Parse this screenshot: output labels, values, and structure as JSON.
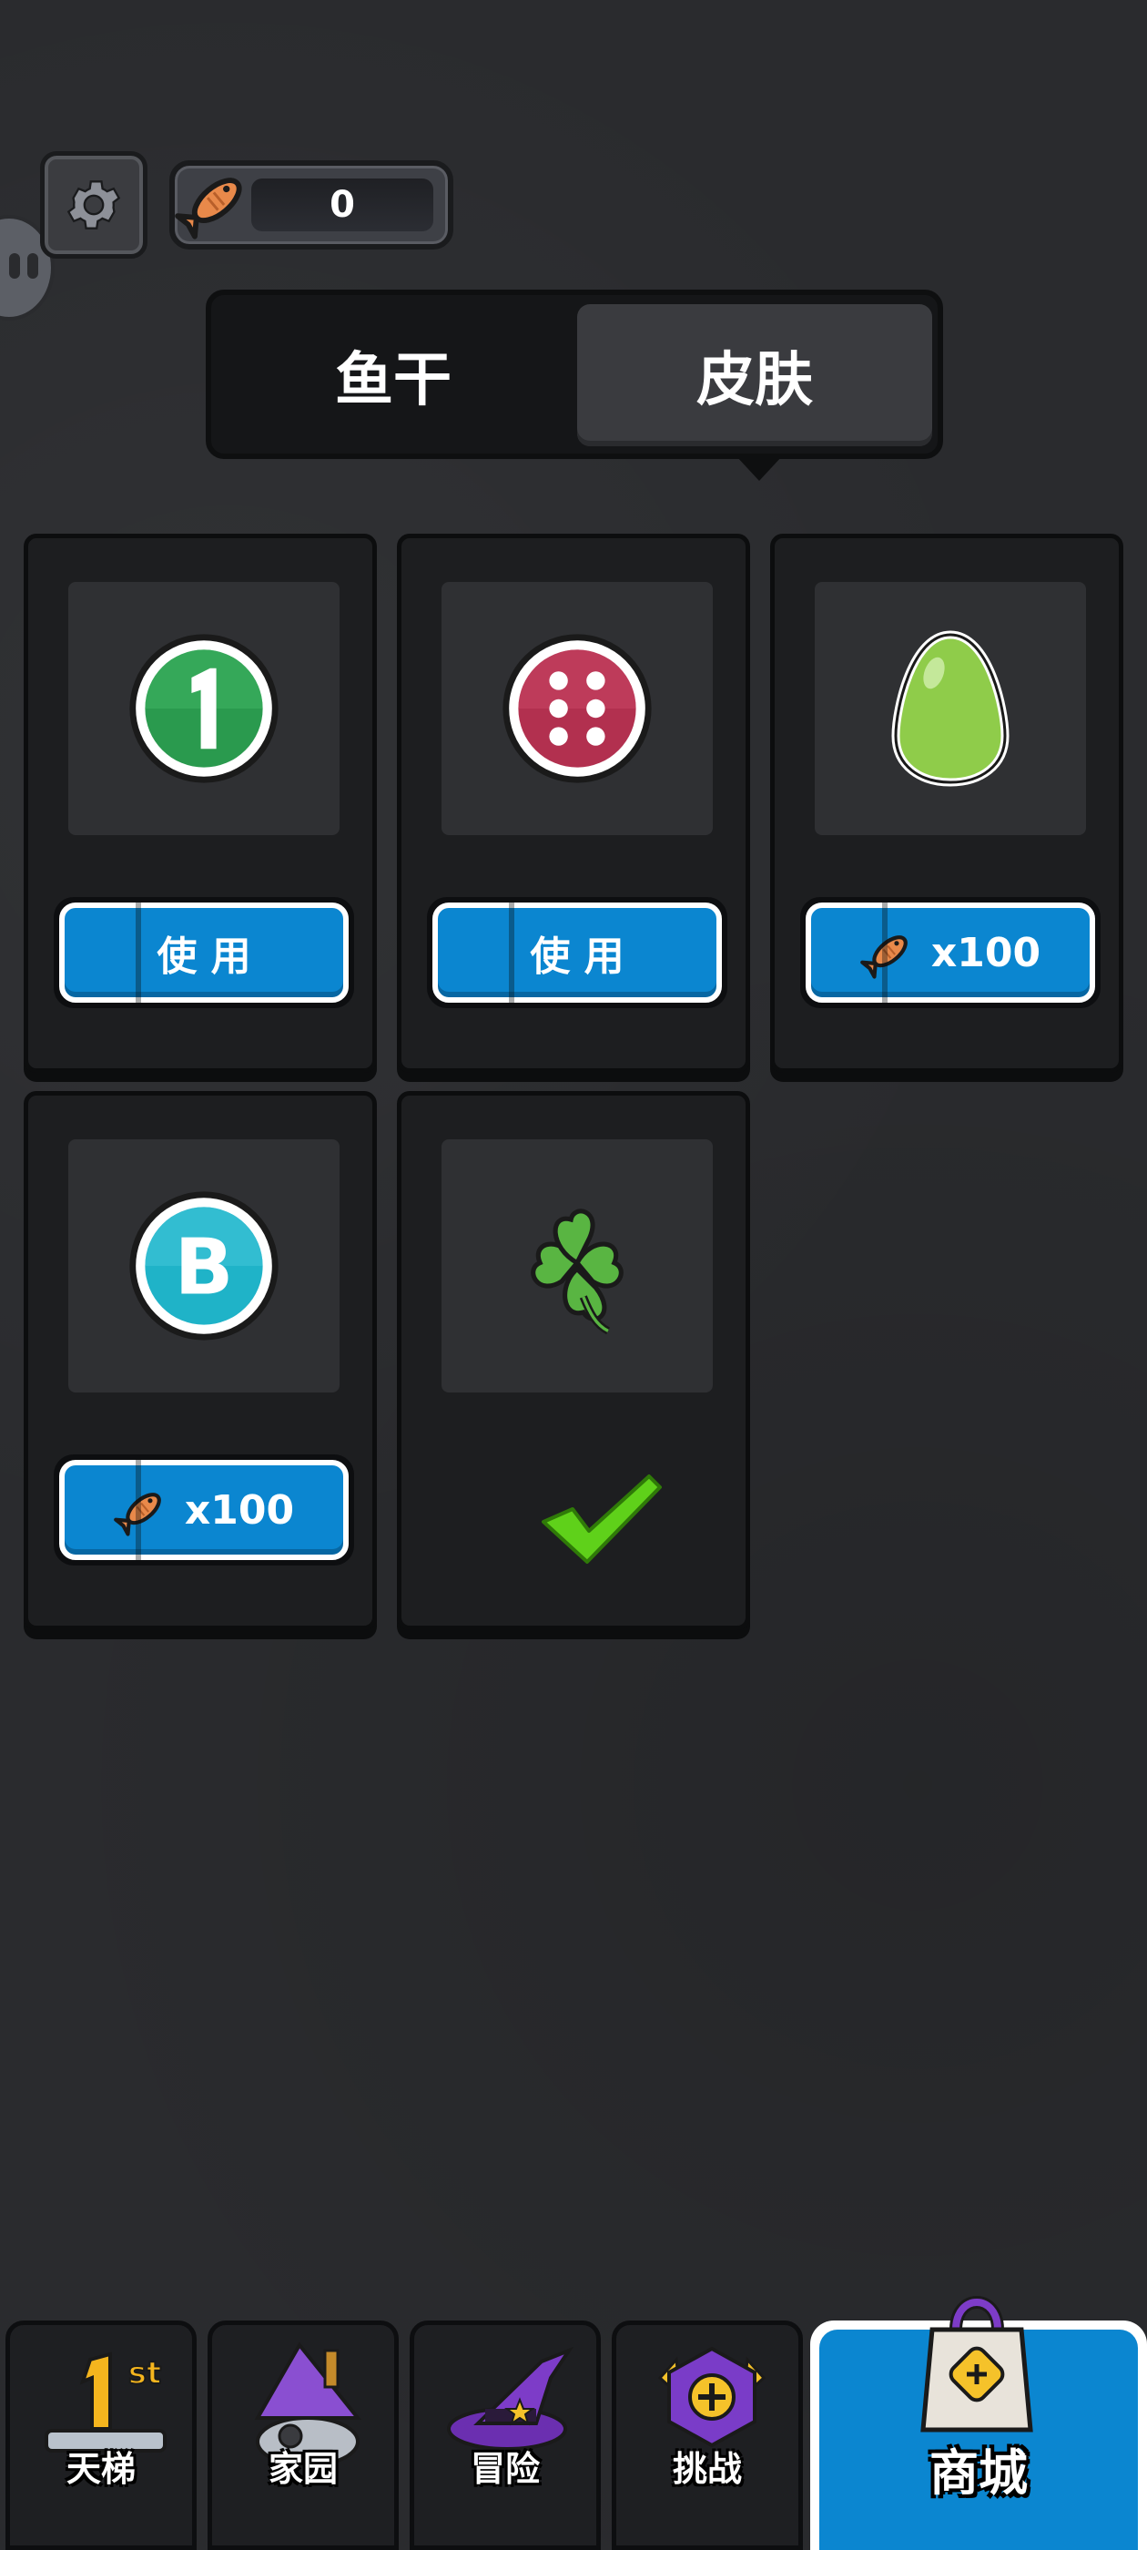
{
  "currency": {
    "amount": "0",
    "icon": "dried-fish-icon"
  },
  "tabs": [
    {
      "label": "鱼干",
      "selected": false
    },
    {
      "label": "皮肤",
      "selected": true
    }
  ],
  "skins": [
    {
      "icon": "green-number-one-icon",
      "button_label": "使 用",
      "state": "owned"
    },
    {
      "icon": "red-dice-six-icon",
      "button_label": "使 用",
      "state": "owned"
    },
    {
      "icon": "green-egg-icon",
      "price": "x100",
      "state": "for-sale"
    },
    {
      "icon": "teal-letter-b-icon",
      "price": "x100",
      "state": "for-sale"
    },
    {
      "icon": "four-leaf-clover-icon",
      "state": "equipped"
    }
  ],
  "bottom_nav": [
    {
      "label": "天梯",
      "icon": "first-place-trophy-icon"
    },
    {
      "label": "家园",
      "icon": "wizard-house-icon"
    },
    {
      "label": "冒险",
      "icon": "wizard-hat-icon"
    },
    {
      "label": "挑战",
      "icon": "challenge-badge-icon"
    },
    {
      "label": "商城",
      "icon": "shopping-bag-icon",
      "active": true
    }
  ],
  "colors": {
    "accent_blue": "#0b86d0",
    "background": "#2a2b2e",
    "check_green": "#5fd11a"
  }
}
